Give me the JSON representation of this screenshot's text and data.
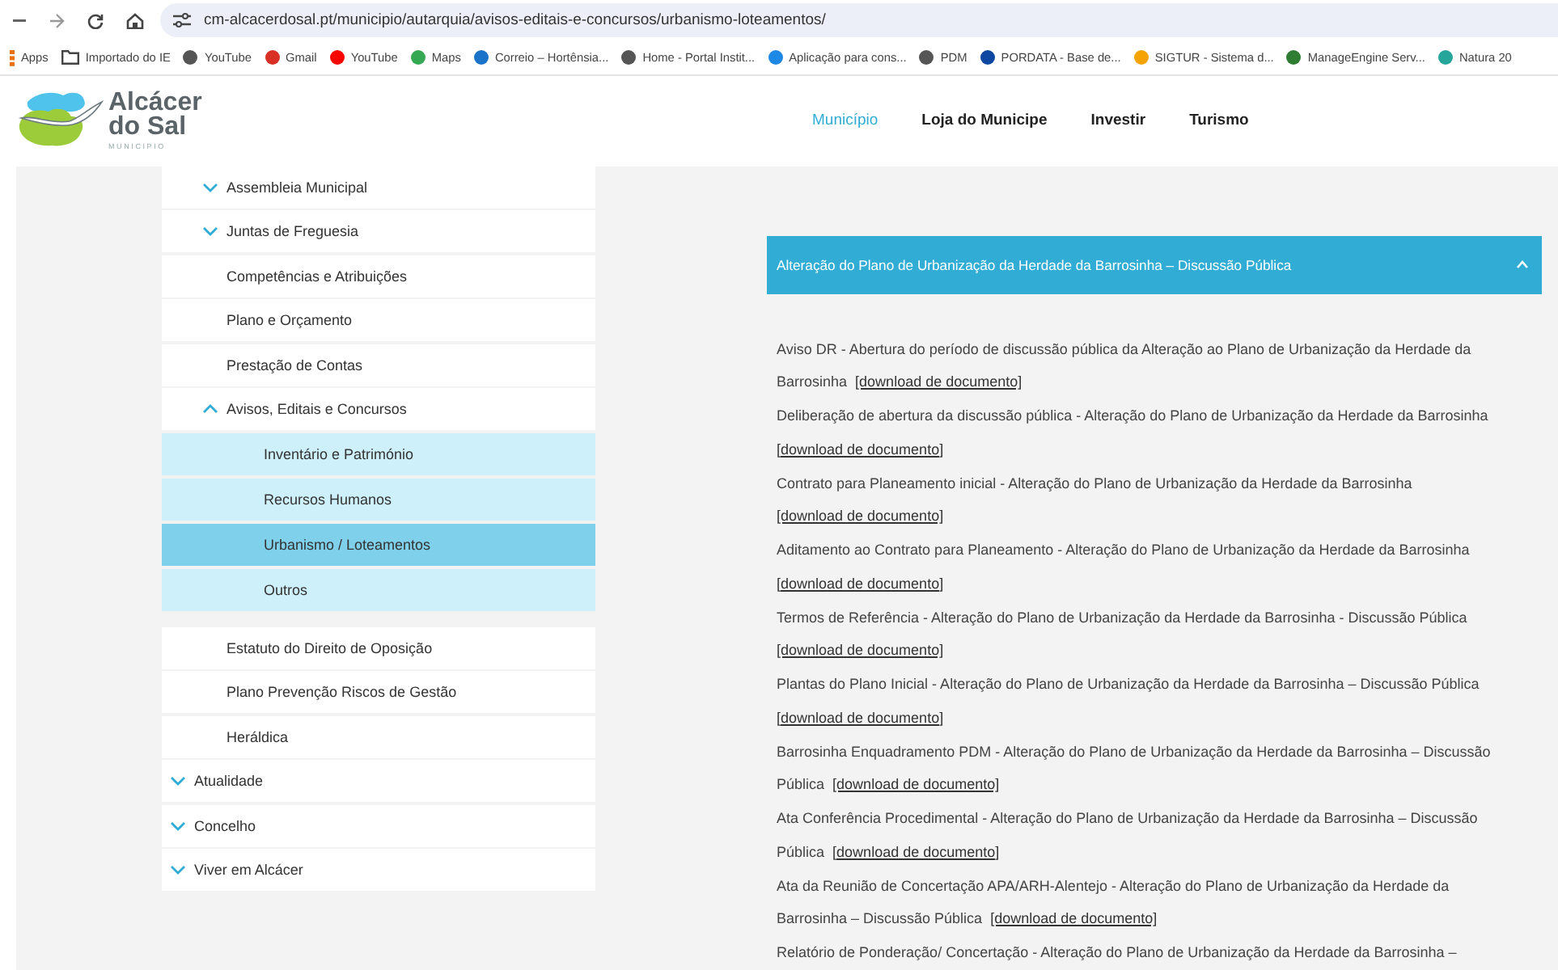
{
  "browser": {
    "url": "cm-alcacerdosal.pt/municipio/autarquia/avisos-editais-e-concursos/urbanismo-loteamentos/",
    "bookmarks": [
      {
        "kind": "apps",
        "label": "Apps",
        "color": "#e8710a"
      },
      {
        "kind": "folder",
        "label": "Importado do IE",
        "color": "#444444"
      },
      {
        "kind": "site",
        "label": "YouTube",
        "color": "#555555"
      },
      {
        "kind": "site",
        "label": "Gmail",
        "color": "#d93025"
      },
      {
        "kind": "site",
        "label": "YouTube",
        "color": "#ff0000"
      },
      {
        "kind": "site",
        "label": "Maps",
        "color": "#34a853"
      },
      {
        "kind": "site",
        "label": "Correio – Hortênsia...",
        "color": "#1a73c8"
      },
      {
        "kind": "site",
        "label": "Home - Portal Instit...",
        "color": "#555555"
      },
      {
        "kind": "site",
        "label": "Aplicação para cons...",
        "color": "#1e88e5"
      },
      {
        "kind": "site",
        "label": "PDM",
        "color": "#555555"
      },
      {
        "kind": "site",
        "label": "PORDATA - Base de...",
        "color": "#0d47a1"
      },
      {
        "kind": "site",
        "label": "SIGTUR - Sistema d...",
        "color": "#f4a300"
      },
      {
        "kind": "site",
        "label": "ManageEngine Serv...",
        "color": "#2e7d32"
      },
      {
        "kind": "site",
        "label": "Natura 20",
        "color": "#26a69a"
      }
    ]
  },
  "header": {
    "logo": {
      "line1": "Alcácer",
      "line2": "do Sal",
      "tagline": "MUNICIPIO"
    },
    "nav": [
      {
        "label": "Município",
        "selected": true
      },
      {
        "label": "Loja do Municipe",
        "selected": false
      },
      {
        "label": "Investir",
        "selected": false
      },
      {
        "label": "Turismo",
        "selected": false
      }
    ]
  },
  "sidebar": {
    "submenu": [
      {
        "label": "Assembleia Municipal",
        "expanded": false
      },
      {
        "label": "Juntas de Freguesia",
        "expanded": false
      },
      {
        "label": "Competências e Atribuições"
      },
      {
        "label": "Plano e Orçamento"
      },
      {
        "label": "Prestação de Contas"
      },
      {
        "label": "Avisos, Editais e Concursos",
        "expanded": true,
        "children": [
          {
            "label": "Inventário e Património",
            "selected": false
          },
          {
            "label": "Recursos Humanos",
            "selected": false
          },
          {
            "label": "Urbanismo / Loteamentos",
            "selected": true
          },
          {
            "label": "Outros",
            "selected": false
          }
        ]
      },
      {
        "label": "Estatuto do Direito de Oposição"
      },
      {
        "label": "Plano Prevenção Riscos de Gestão"
      },
      {
        "label": "Heráldica"
      }
    ],
    "items": [
      {
        "label": "Atualidade",
        "expanded": false
      },
      {
        "label": "Concelho",
        "expanded": false
      },
      {
        "label": "Viver em Alcácer",
        "expanded": false
      }
    ]
  },
  "panel": {
    "title": "Alteração do Plano de Urbanização da Herdade da Barrosinha – Discussão Pública",
    "expanded": true,
    "documents": [
      {
        "text": "Aviso DR - Abertura do período de discussão pública da Alteração ao Plano de Urbanização da Herdade da Barrosinha",
        "link": "[download de documento]"
      },
      {
        "text": "Deliberação de abertura da discussão pública - Alteração do Plano de Urbanização da Herdade da Barrosinha",
        "link": "[download de documento]"
      },
      {
        "text": "Contrato para Planeamento inicial - Alteração do Plano de Urbanização da Herdade da Barrosinha",
        "link": "[download de documento]"
      },
      {
        "text": "Aditamento ao Contrato para Planeamento - Alteração do Plano de Urbanização da Herdade da Barrosinha",
        "link": "[download de documento]"
      },
      {
        "text": "Termos de Referência - Alteração do Plano de Urbanização da Herdade da Barrosinha - Discussão Pública",
        "link": "[download de documento]"
      },
      {
        "text": "Plantas do Plano Inicial - Alteração do Plano de Urbanização da Herdade da Barrosinha – Discussão Pública",
        "link": "[download de documento]"
      },
      {
        "text": "Barrosinha Enquadramento PDM - Alteração do Plano de Urbanização da Herdade da Barrosinha – Discussão Pública",
        "link": "[download de documento]"
      },
      {
        "text": "Ata Conferência Procedimental - Alteração do Plano de Urbanização da Herdade da Barrosinha – Discussão Pública",
        "link": "[download de documento]"
      },
      {
        "text": "Ata da Reunião de Concertação APA/ARH-Alentejo - Alteração do Plano de Urbanização da Herdade da Barrosinha – Discussão Pública",
        "link": "[download de documento]"
      },
      {
        "text": "Relatório de Ponderação/ Concertação - Alteração do Plano de Urbanização da Herdade da Barrosinha –"
      }
    ]
  }
}
